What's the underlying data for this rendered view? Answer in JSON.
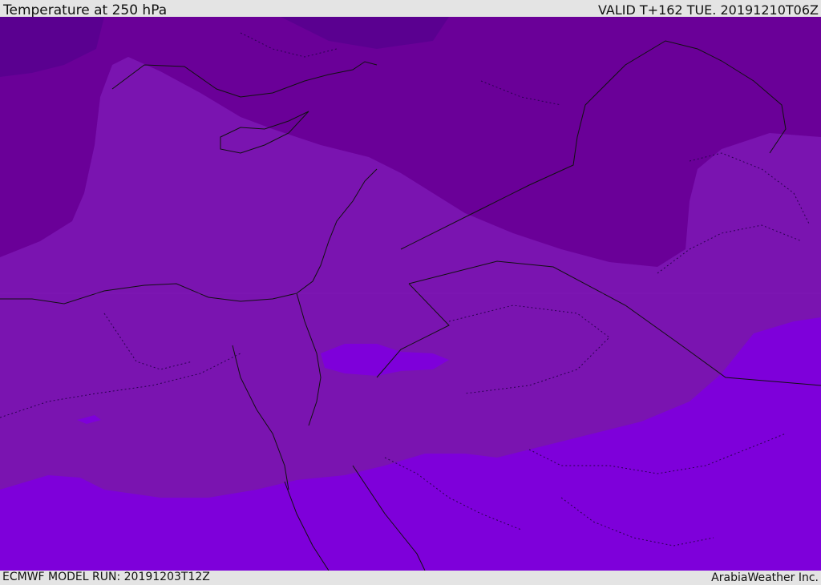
{
  "header": {
    "title": "Temperature at 250 hPa",
    "valid": "VALID T+162 TUE. 20191210T06Z"
  },
  "footer": {
    "model_run": "ECMWF MODEL RUN: 20191203T12Z",
    "brand": "ArabiaWeather Inc."
  },
  "map": {
    "variable": "temperature",
    "pressure_level": "250 hPa",
    "colors": {
      "coldest": "#5a0090",
      "colder": "#6a0098",
      "mid": "#7a14b0",
      "warm": "#7e00da",
      "warmest_highlight": "#8a22e8",
      "coastline": "#111111"
    }
  }
}
